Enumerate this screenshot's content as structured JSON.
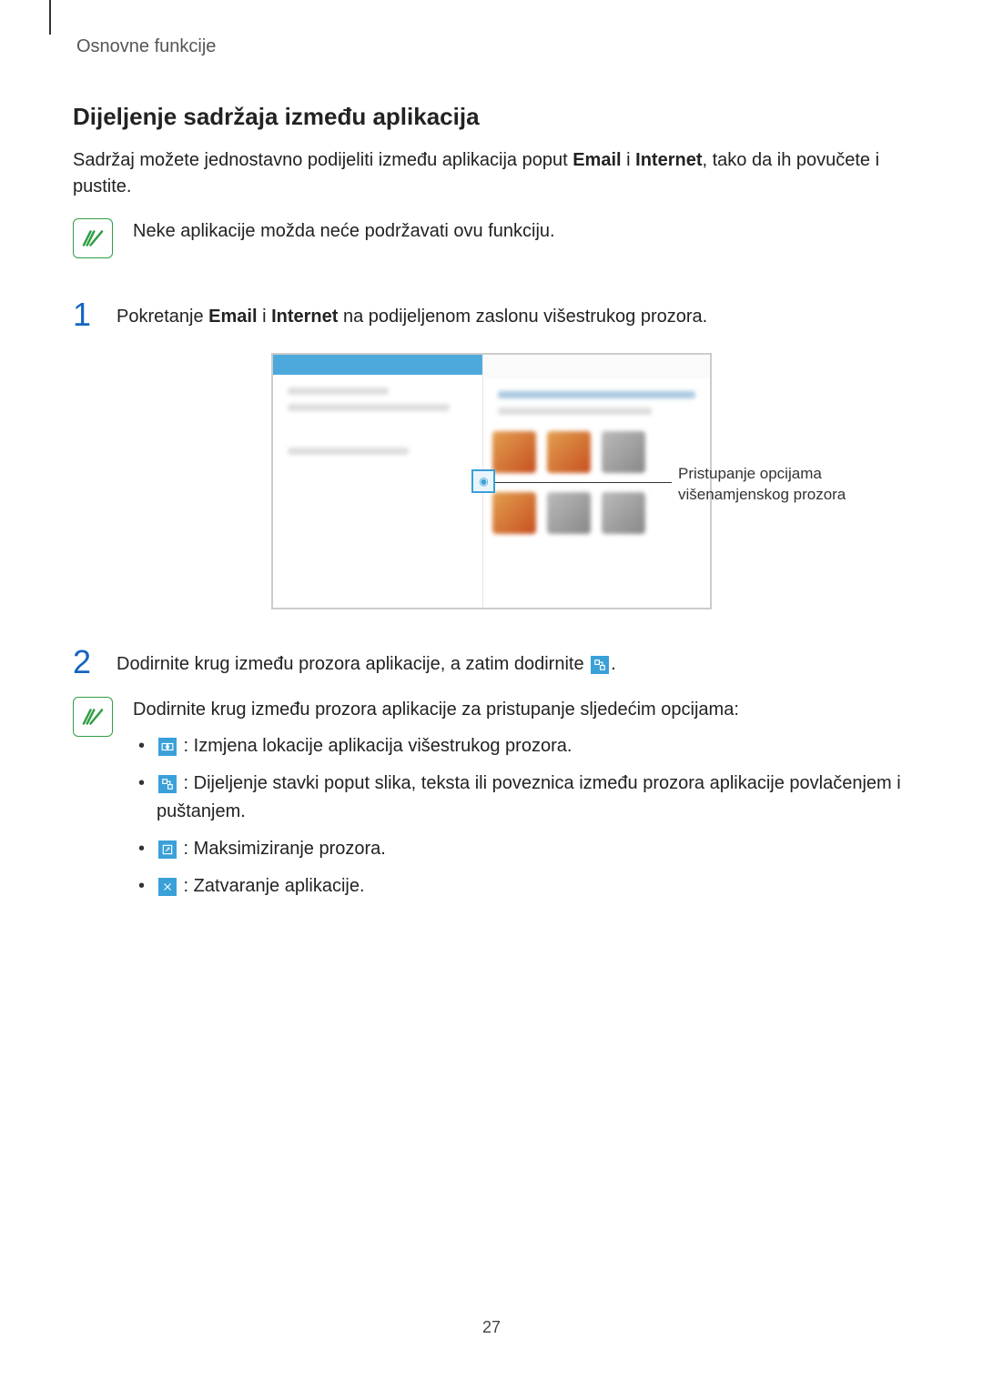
{
  "header": "Osnovne funkcije",
  "section_title": "Dijeljenje sadržaja između aplikacija",
  "intro": {
    "pre": "Sadržaj možete jednostavno podijeliti između aplikacija poput ",
    "b1": "Email",
    "mid1": " i ",
    "b2": "Internet",
    "post": ", tako da ih povučete i pustite."
  },
  "note1": "Neke aplikacije možda neće podržavati ovu funkciju.",
  "step1": {
    "num": "1",
    "pre": "Pokretanje ",
    "b1": "Email",
    "mid": " i ",
    "b2": "Internet",
    "post": " na podijeljenom zaslonu višestrukog prozora."
  },
  "callout": "Pristupanje opcijama višenamjenskog prozora",
  "step2": {
    "num": "2",
    "pre": "Dodirnite krug između prozora aplikacije, a zatim dodirnite ",
    "post": "."
  },
  "note2_lead": "Dodirnite krug između prozora aplikacije za pristupanje sljedećim opcijama:",
  "opts": {
    "swap": " : Izmjena lokacije aplikacija višestrukog prozora.",
    "share": " : Dijeljenje stavki poput slika, teksta ili poveznica između prozora aplikacije povlačenjem i puštanjem.",
    "max": " : Maksimiziranje prozora.",
    "close": " : Zatvaranje aplikacije."
  },
  "page_number": "27"
}
